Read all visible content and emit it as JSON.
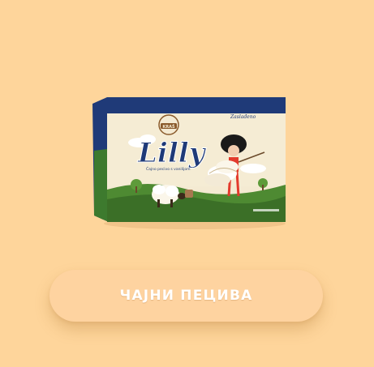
{
  "product": {
    "brand_logo_text": "KRAŠ",
    "product_name": "Lilly",
    "package_subtitle": "Čajno pecivo s vanilijom",
    "package_tagline": "Zaslađeno",
    "image_alt": "Lilly"
  },
  "category": {
    "label": "ЧАЈНИ ПЕЦИВА"
  },
  "colors": {
    "background": "#fed59b",
    "package_navy": "#1f3a78",
    "package_cream": "#f4ead2",
    "button_text": "#ffffff"
  }
}
